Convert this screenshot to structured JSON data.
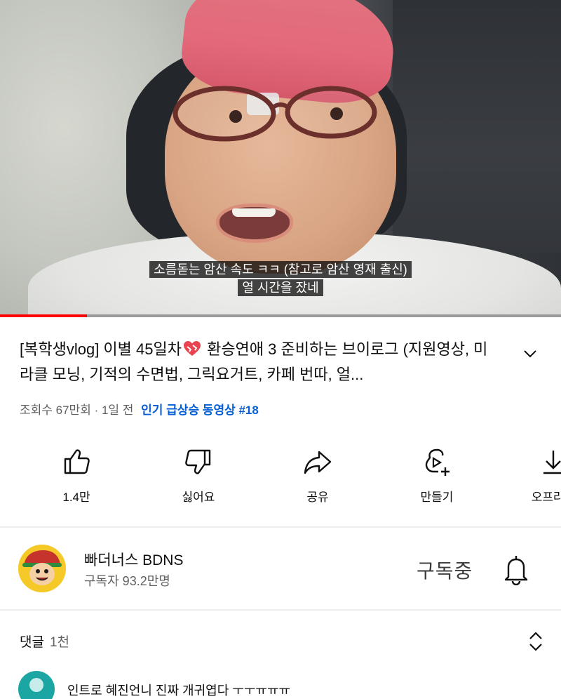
{
  "player": {
    "caption_line1": "소름돋는 암산 속도 ㅋㅋ (참고로 암산 영재 출신)",
    "caption_line2": "열 시간을 잤네",
    "progress_fraction": 0.155,
    "progress_color": "#ff0000"
  },
  "video": {
    "title_part1": "[복학생vlog] 이별 45일차",
    "title_emoji": "mending-heart-emoji",
    "title_part2": " 환승연애 3 준비하는 브이로그 (지원영상, 미라클 모닝, 기적의 수면법, 그릭요거트, 카페 번따, 얼...",
    "views": "조회수 67만회",
    "age": "· 1일 전",
    "trending": "인기 급상승 동영상 #18",
    "trending_color": "#065fd4"
  },
  "actions": [
    {
      "icon": "thumbs-up-icon",
      "label": "1.4만"
    },
    {
      "icon": "thumbs-down-icon",
      "label": "싫어요"
    },
    {
      "icon": "share-icon",
      "label": "공유"
    },
    {
      "icon": "remix-icon",
      "label": "만들기"
    },
    {
      "icon": "download-icon",
      "label": "오프라인"
    }
  ],
  "channel": {
    "name": "빠더너스 BDNS",
    "subscribers": "구독자 93.2만명",
    "subscribe_state": "구독중"
  },
  "comments": {
    "title": "댓글",
    "count": "1천",
    "first_comment": "인트로 혜진언니 진짜 개귀엽다 ㅜㅜㅠㅠㅠ"
  }
}
